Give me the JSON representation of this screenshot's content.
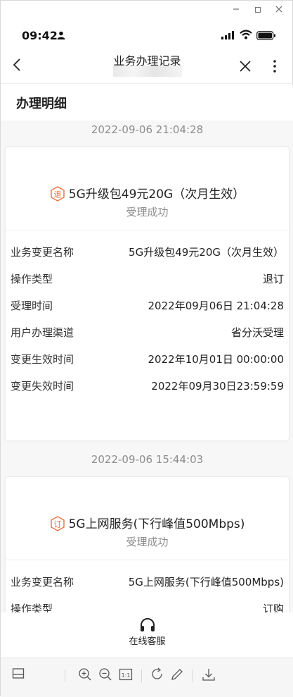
{
  "status_bar": {
    "time": "09:42"
  },
  "nav": {
    "title": "业务办理记录"
  },
  "section": {
    "title": "办理明细"
  },
  "records": [
    {
      "date": "2022-09-06 21:04:28",
      "tag": "退",
      "title": "5G升级包49元20G（次月生效）",
      "status": "受理成功",
      "rows": [
        {
          "label": "业务变更名称",
          "value": "5G升级包49元20G（次月生效）"
        },
        {
          "label": "操作类型",
          "value": "退订"
        },
        {
          "label": "受理时间",
          "value": "2022年09月06日 21:04:28"
        },
        {
          "label": "用户办理渠道",
          "value": "省分沃受理"
        },
        {
          "label": "变更生效时间",
          "value": "2022年10月01日 00:00:00"
        },
        {
          "label": "变更失效时间",
          "value": "2022年09月30日23:59:59"
        }
      ]
    },
    {
      "date": "2022-09-06 15:44:03",
      "tag": "订",
      "title": "5G上网服务(下行峰值500Mbps)",
      "status": "受理成功",
      "rows": [
        {
          "label": "业务变更名称",
          "value": "5G上网服务(下行峰值500Mbps)"
        },
        {
          "label": "操作类型",
          "value": "订购"
        }
      ]
    }
  ],
  "support": {
    "label": "在线客服"
  },
  "toolbar": {
    "items": [
      "sidebar-toggle-icon",
      "zoom-in-icon",
      "zoom-out-icon",
      "actual-size-icon",
      "rotate-icon",
      "edit-icon",
      "download-icon"
    ],
    "actual_size_label": "1:1"
  },
  "colors": {
    "accent": "#e8703a",
    "muted": "#8d8d8d"
  }
}
